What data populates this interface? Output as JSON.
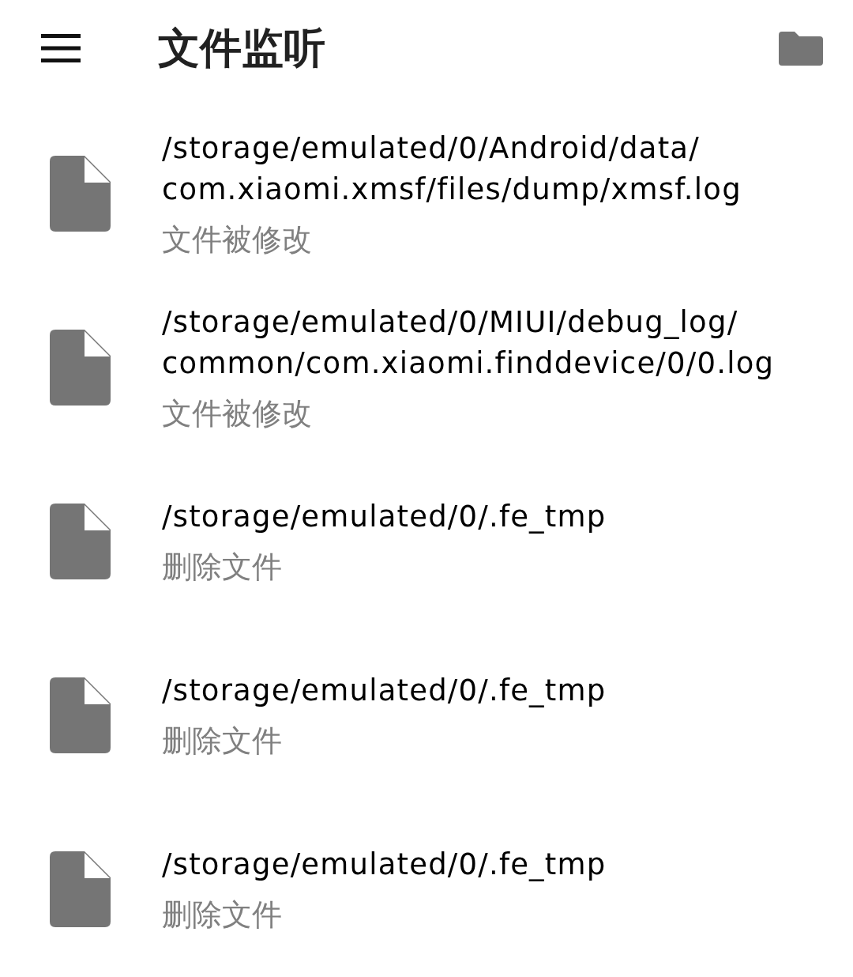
{
  "app_bar": {
    "title": "文件监听"
  },
  "events": [
    {
      "path": "/storage/emulated/0/Android/data/com.xiaomi.xmsf/files/dump/xmsf.log",
      "action": "文件被修改"
    },
    {
      "path": "/storage/emulated/0/MIUI/debug_log/common/com.xiaomi.finddevice/0/0.log",
      "action": "文件被修改"
    },
    {
      "path": "/storage/emulated/0/.fe_tmp",
      "action": "删除文件"
    },
    {
      "path": "/storage/emulated/0/.fe_tmp",
      "action": "删除文件"
    },
    {
      "path": "/storage/emulated/0/.fe_tmp",
      "action": "删除文件"
    }
  ]
}
